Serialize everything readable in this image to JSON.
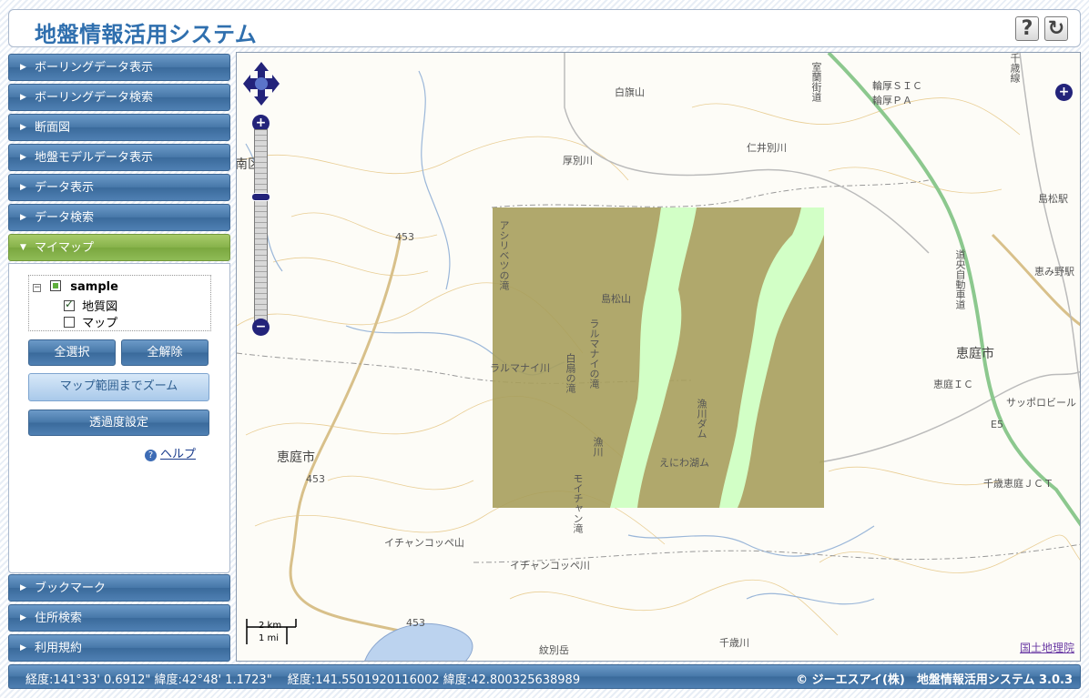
{
  "header": {
    "title": "地盤情報活用システム",
    "help_icon": "question-icon",
    "reset_icon": "refresh-icon"
  },
  "sidebar": {
    "top_items": [
      {
        "label": "ボーリングデータ表示"
      },
      {
        "label": "ボーリングデータ検索"
      },
      {
        "label": "断面図"
      },
      {
        "label": "地盤モデルデータ表示"
      },
      {
        "label": "データ表示"
      },
      {
        "label": "データ検索"
      },
      {
        "label": "マイマップ"
      }
    ],
    "bottom_items": [
      {
        "label": "ブックマーク"
      },
      {
        "label": "住所検索"
      },
      {
        "label": "利用規約"
      }
    ],
    "mymap": {
      "tree_root": "sample",
      "layers": [
        {
          "label": "地質図",
          "checked": true
        },
        {
          "label": "マップ",
          "checked": false
        }
      ],
      "select_all": "全選択",
      "deselect_all": "全解除",
      "zoom_to_extent": "マップ範囲までズーム",
      "transparency": "透過度設定",
      "help": "ヘルプ"
    }
  },
  "map": {
    "labels": {
      "shirahata": "白旗山",
      "atsubetsu": "厚別川",
      "niibetsu": "仁井別川",
      "wawa": "輪厚ＳＩＣ",
      "wawa_pa": "輪厚ＰＡ",
      "shimamatsu_eki": "島松駅",
      "eniwa_city_right": "恵庭市",
      "eniwa_ic": "恵庭ＩＣ",
      "sapporo_beer": "サッポロビール",
      "megumino": "恵み野駅",
      "chitose_jct": "千歳恵庭ＪＣＴ",
      "eniwa_city_left": "恵庭市",
      "ichankoppe_mt": "イチャンコッペ山",
      "ichankoppe_river": "イチャンコッペ川",
      "rarumanai": "ラルマナイ川",
      "shimamatsuyama": "島松山",
      "eniwa_dam": "えにわ湖ム",
      "chitose_river": "千歳川",
      "monbetsu": "紋別岳",
      "minami_ku": "南区",
      "route_453a": "453",
      "route_453b": "453",
      "route_453c": "453",
      "route_e5": "E5",
      "ashisetsu": "アシリベツの滝",
      "rarumanai_falls": "ラルマナイの滝",
      "shirasago": "白扇の滝",
      "moichan": "モイチャン滝",
      "gyosen": "漁川",
      "gyosen_dam": "漁川ダム",
      "shirahata_road": "室蘭街道",
      "hokkaido_exp": "道央自動車道",
      "chitose_line": "千歳線"
    },
    "scale_km": "2 km",
    "scale_mi": "1 mi",
    "attribution": "国土地理院",
    "overlay_color": "#a79e5c",
    "highlight_color": "#d2ffc6"
  },
  "footer": {
    "coords": "経度:141°33' 0.6912\" 緯度:42°48' 1.1723\"　 経度:141.5501920116002 緯度:42.800325638989",
    "copyright": "© ジーエスアイ(株)　地盤情報活用システム 3.0.3"
  }
}
